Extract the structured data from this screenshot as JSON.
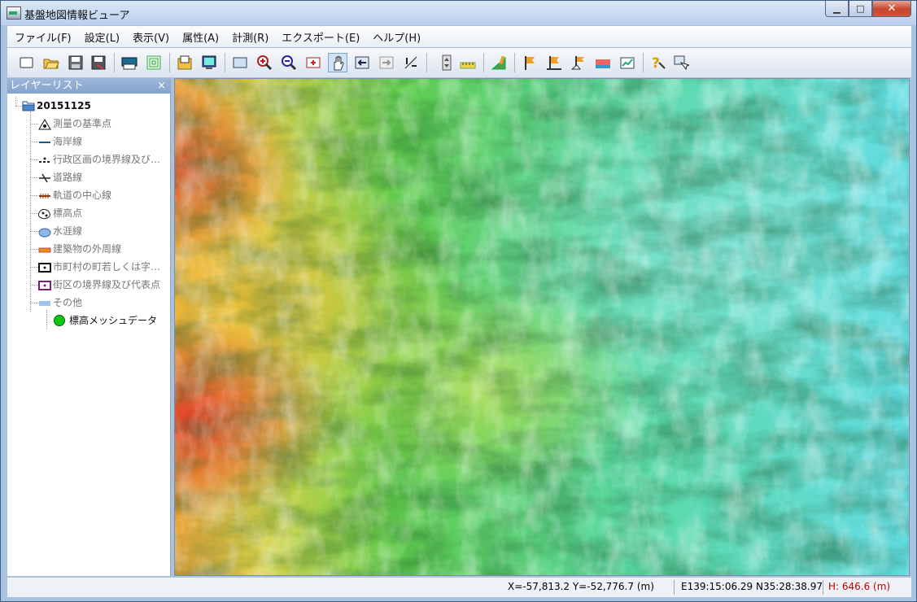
{
  "window": {
    "title": "基盤地図情報ビューア"
  },
  "window_buttons": {
    "minimize": "▁",
    "maximize": "□",
    "close": "✕"
  },
  "menu": [
    {
      "label": "ファイル(F)"
    },
    {
      "label": "設定(L)"
    },
    {
      "label": "表示(V)"
    },
    {
      "label": "属性(A)"
    },
    {
      "label": "計測(R)"
    },
    {
      "label": "エクスポート(E)"
    },
    {
      "label": "ヘルプ(H)"
    }
  ],
  "toolbar_icons": [
    "new-icon",
    "open-folder-icon",
    "save-icon",
    "save-as-icon",
    "print-icon",
    "contour-icon",
    "import-icon",
    "display-icon",
    "full-extent-icon",
    "zoom-in-icon",
    "zoom-out-icon",
    "zoom-rect-icon",
    "pan-hand-icon",
    "back-icon",
    "forward-icon",
    "scale-ratio-icon",
    "elevation-scale-icon",
    "ruler-icon",
    "draw-icon",
    "flag-icon",
    "flag-add-icon",
    "flag-edit-icon",
    "color-bar-icon",
    "chart-icon",
    "help-query-icon",
    "property-icon"
  ],
  "panel": {
    "title": "レイヤーリスト",
    "close": "×",
    "root": "20151125",
    "layers": [
      {
        "label": "測量の基準点",
        "icon": "survey-point-icon"
      },
      {
        "label": "海岸線",
        "icon": "coastline-icon"
      },
      {
        "label": "行政区画の境界線及び…",
        "icon": "admin-boundary-icon"
      },
      {
        "label": "道路線",
        "icon": "road-icon"
      },
      {
        "label": "軌道の中心線",
        "icon": "railway-icon"
      },
      {
        "label": "標高点",
        "icon": "elevation-point-icon"
      },
      {
        "label": "水涯線",
        "icon": "waterline-icon"
      },
      {
        "label": "建築物の外周線",
        "icon": "building-icon"
      },
      {
        "label": "市町村の町若しくは字…",
        "icon": "town-boundary-icon"
      },
      {
        "label": "街区の境界線及び代表点",
        "icon": "block-boundary-icon"
      },
      {
        "label": "その他",
        "icon": "other-icon"
      }
    ],
    "active_layer": {
      "label": "標高メッシュデータ",
      "icon": "elevation-mesh-icon"
    }
  },
  "status": {
    "xy": "X=-57,813.2 Y=-52,776.7 (m)",
    "latlon": "E139:15:06.29 N35:28:38.97",
    "height": "H: 646.6 (m)"
  },
  "colors": {
    "height_text": "#c00000",
    "map_low": "#5fe0e6",
    "map_mid": "#45c95a",
    "map_high": "#e8502a"
  }
}
